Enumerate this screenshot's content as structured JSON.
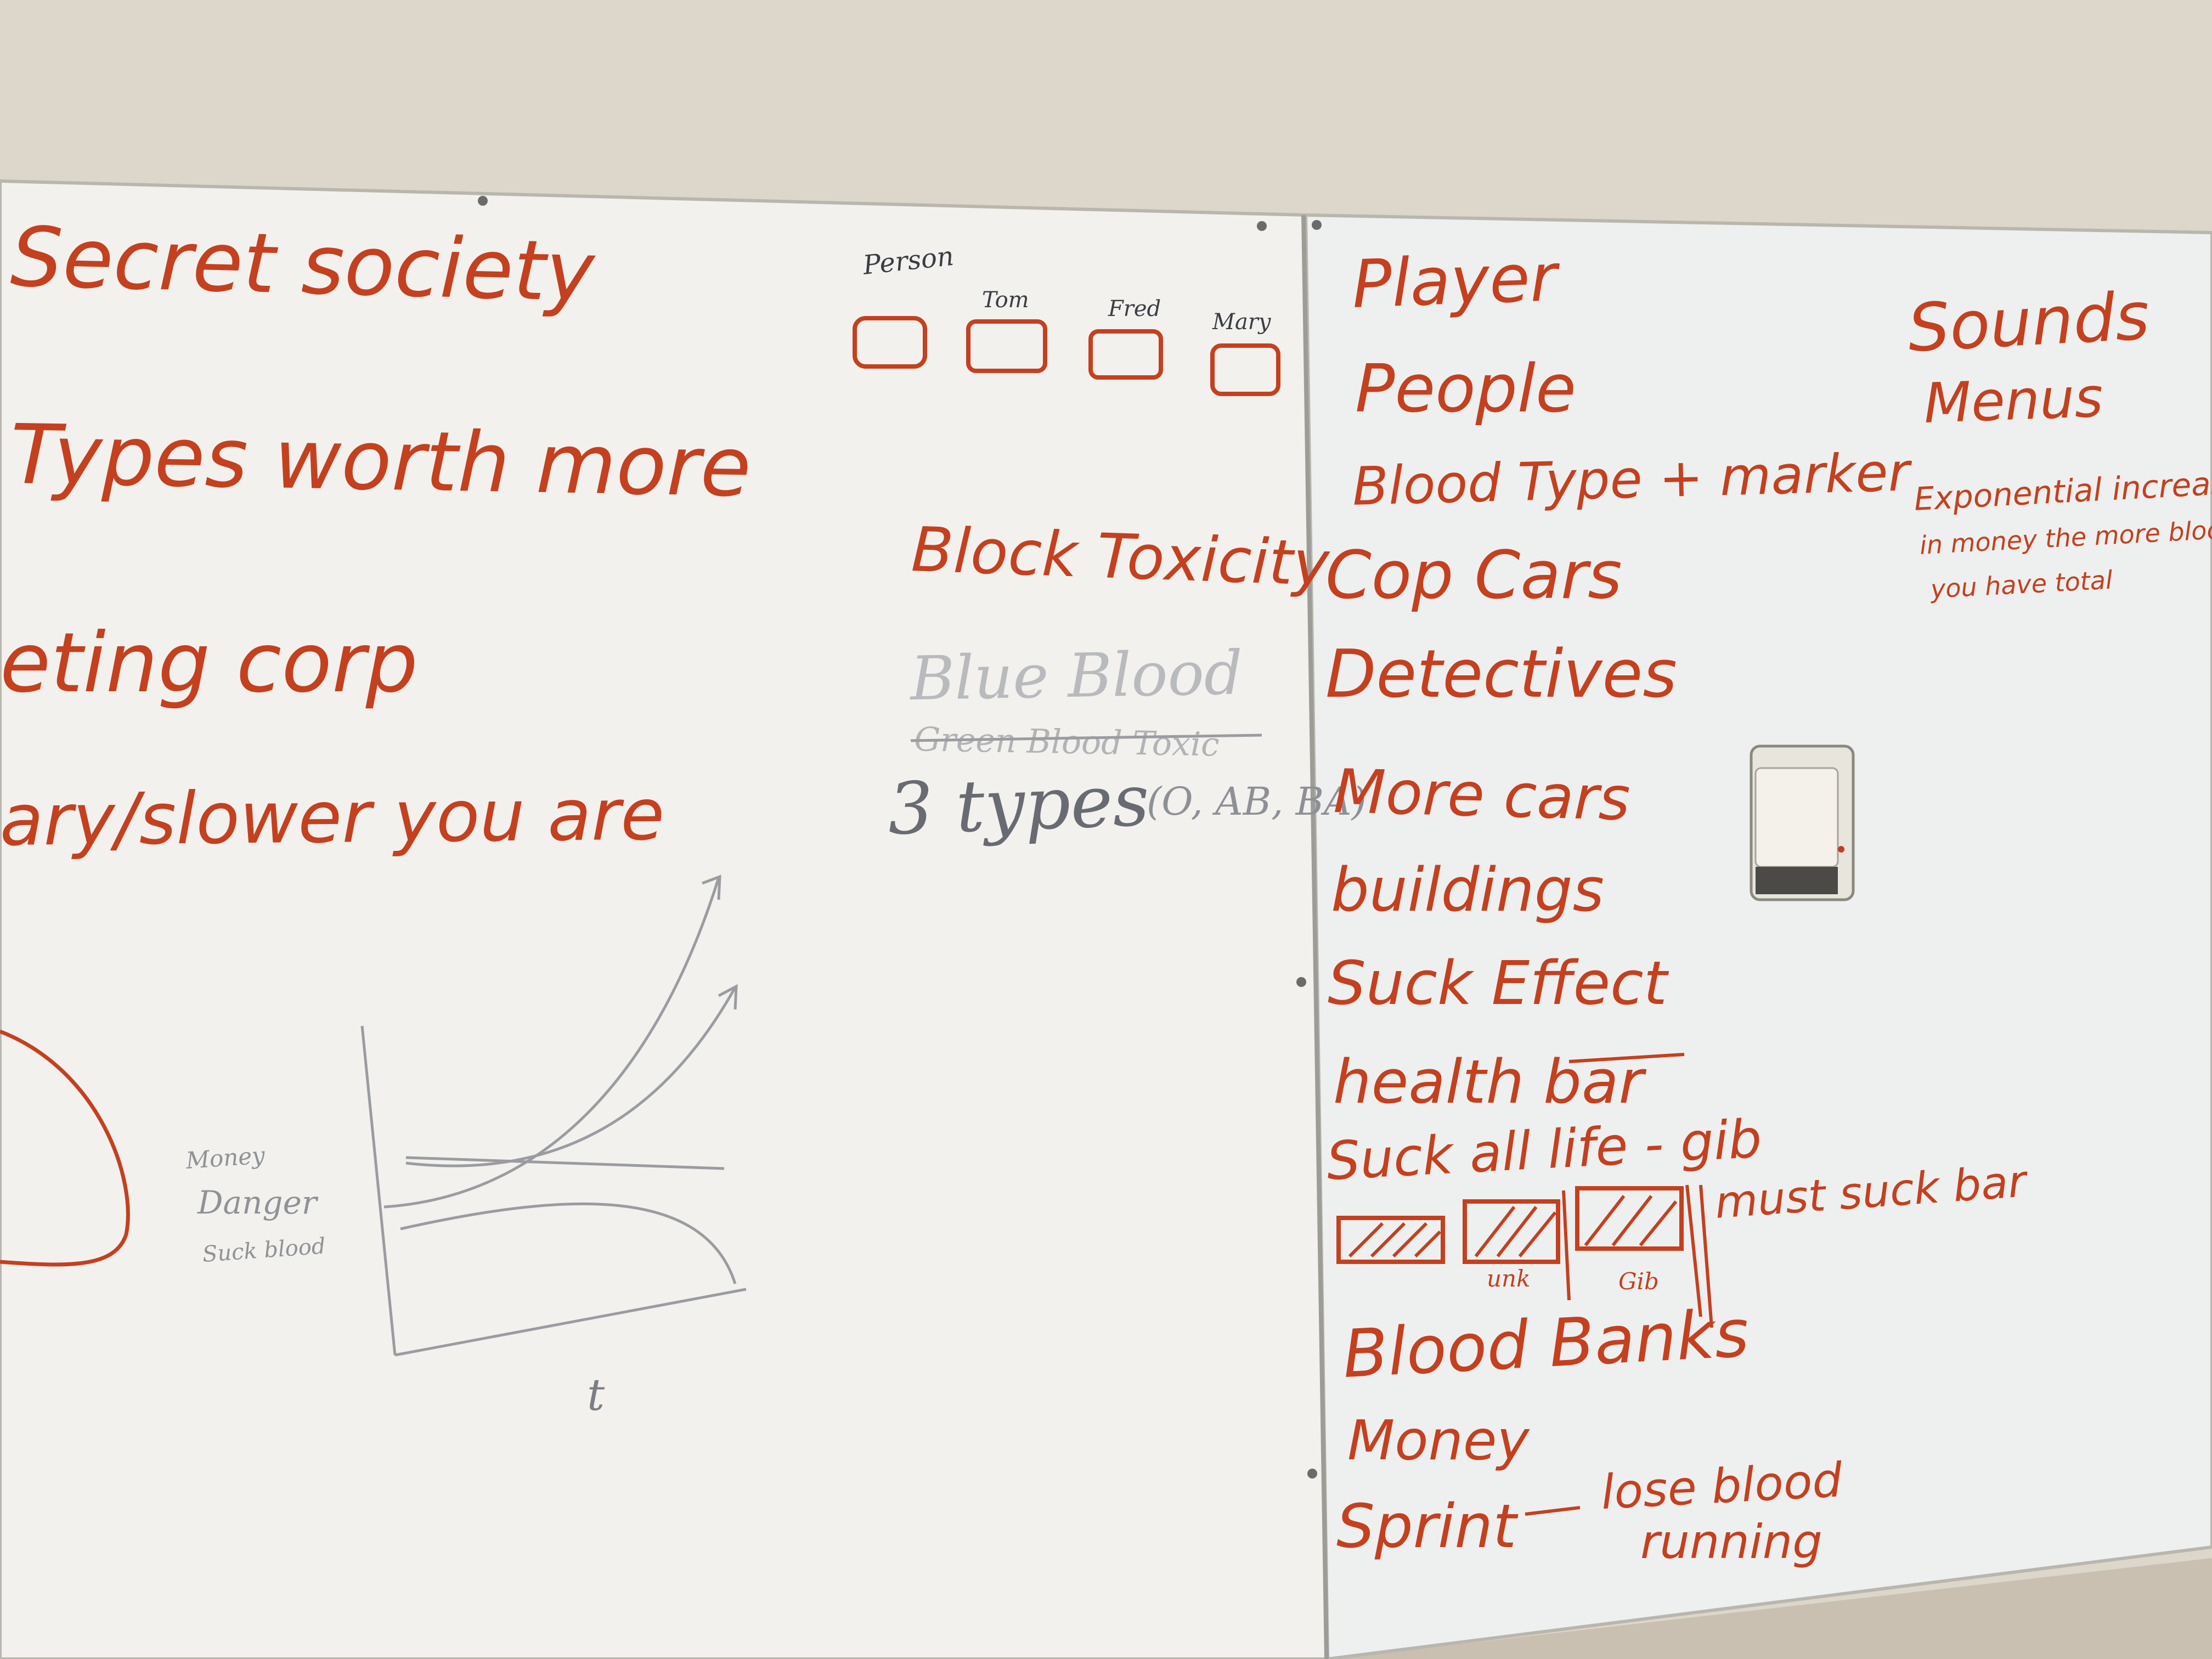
{
  "colors": {
    "wall": "#ddd6ca",
    "board": "#f1f0ec",
    "board_right": "#eef0ef",
    "red_marker": "#c4401f",
    "gray_marker": "#8a8d92"
  },
  "left_panel": {
    "title": "Secret society",
    "line2": "Types worth more",
    "line3": "eting corp",
    "line4": "ary/slower you are",
    "person_label": "Person",
    "names": [
      "Tom",
      "Fred",
      "Mary"
    ],
    "block_toxicity": "Block Toxicity",
    "blue_blood": "Blue Blood",
    "green_blood": "Green Blood Toxic",
    "three_types": "3 types",
    "graph": {
      "legend": [
        "Money",
        "Danger",
        "Suck blood"
      ],
      "x_axis": "t"
    }
  },
  "right_panel": {
    "list": [
      "Player",
      "People",
      "Blood Type + marker",
      "Cop Cars",
      "Detectives",
      "More cars",
      "buildings",
      "Suck Effect",
      "health bar",
      "Suck all life - gib",
      "Blood Banks",
      "Money",
      "Sprint"
    ],
    "must_suck_bar": "must suck bar",
    "gib_labels": [
      "unk",
      "Gib"
    ],
    "sprint_note_1": "lose blood",
    "sprint_note_2": "running",
    "sounds": "Sounds",
    "menus": "Menus",
    "money_note": [
      "Exponential increase",
      "in money the more blood",
      "you have total"
    ]
  }
}
